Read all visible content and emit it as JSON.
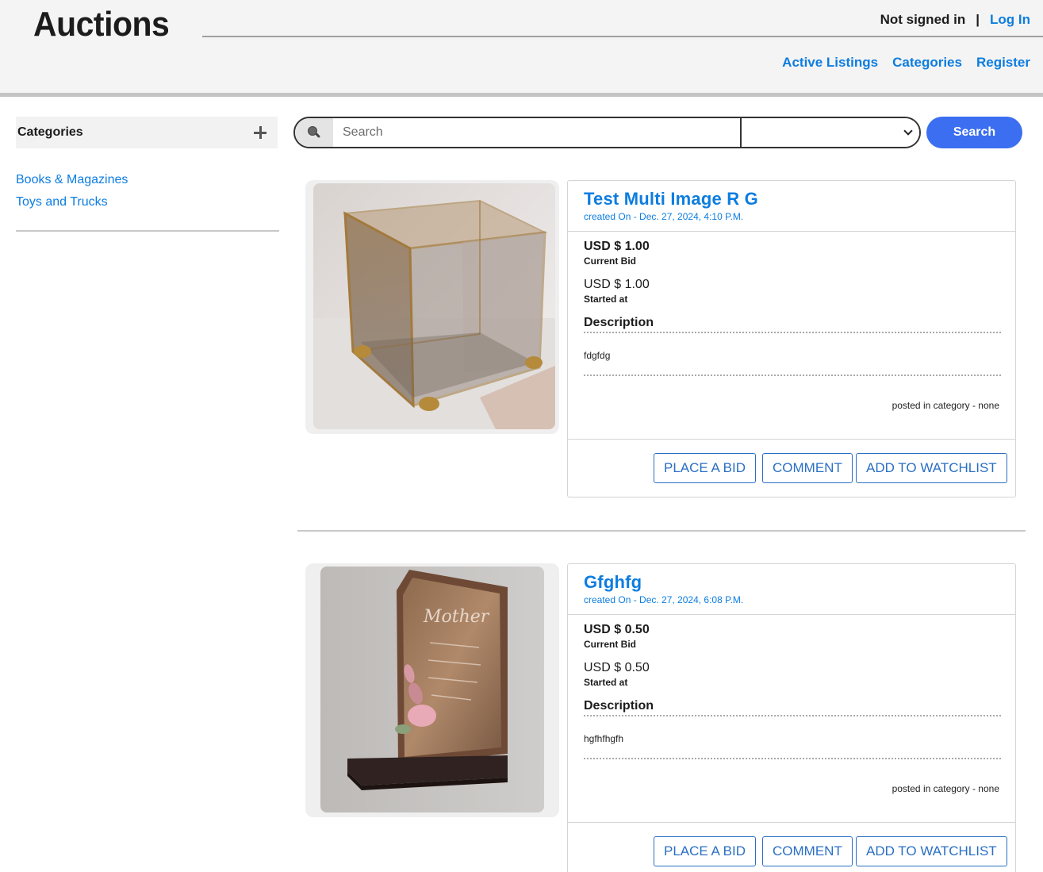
{
  "header": {
    "site_title": "Auctions",
    "auth_status": "Not signed in",
    "separator": "|",
    "login_label": "Log In",
    "nav": [
      "Active Listings",
      "Categories",
      "Register"
    ]
  },
  "sidebar": {
    "heading": "Categories",
    "items": [
      "Books & Magazines",
      "Toys and Trucks"
    ]
  },
  "search": {
    "placeholder": "Search",
    "value": "",
    "category_value": "",
    "button_label": "Search"
  },
  "listings": [
    {
      "title": "Test Multi Image R G",
      "created": "created On - Dec. 27, 2024, 4:10 P.M.",
      "current_bid": "USD $ 1.00",
      "current_bid_label": "Current Bid",
      "start_price": "USD $ 1.00",
      "start_label": "Started at",
      "description_heading": "Description",
      "description": "fdgfdg",
      "posted": "posted in category - none",
      "actions": [
        "PLACE A BID",
        "COMMENT",
        "ADD TO WATCHLIST"
      ]
    },
    {
      "title": "Gfghfg",
      "created": "created On - Dec. 27, 2024, 6:08 P.M.",
      "current_bid": "USD $ 0.50",
      "current_bid_label": "Current Bid",
      "start_price": "USD $ 0.50",
      "start_label": "Started at",
      "description_heading": "Description",
      "description": "hgfhfhgfh",
      "posted": "posted in category - none",
      "actions": [
        "PLACE A BID",
        "COMMENT",
        "ADD TO WATCHLIST"
      ]
    }
  ],
  "colors": {
    "link": "#0d7de0",
    "search_button": "#3b6ef0",
    "action_border": "#2a6fc4",
    "header_bg": "#f4f4f4"
  },
  "icons": [
    "plus-icon",
    "search-icon",
    "chevron-down-icon"
  ]
}
